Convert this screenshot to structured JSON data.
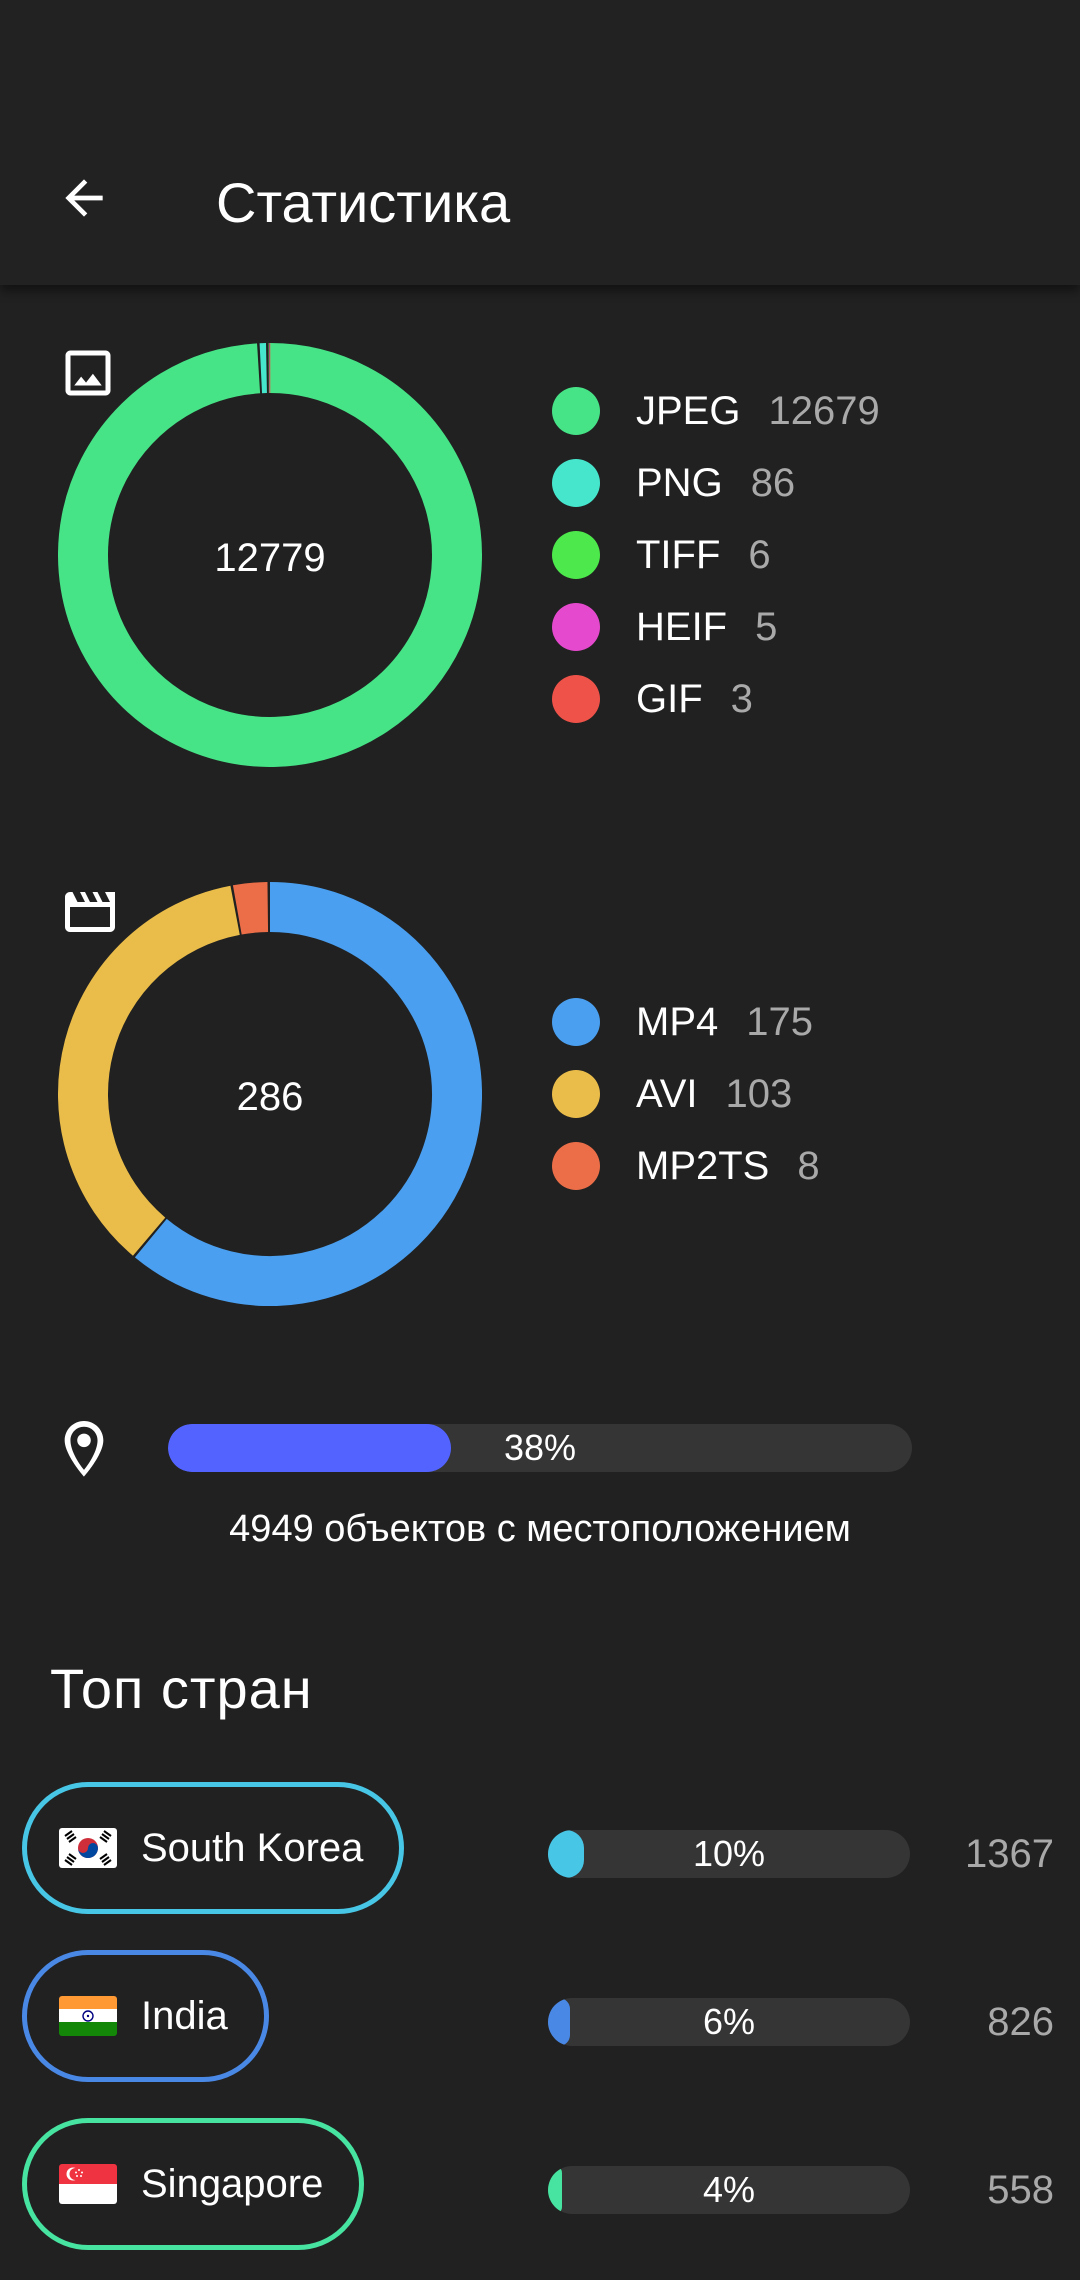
{
  "header": {
    "title": "Статистика",
    "back_icon": "arrow-back-icon"
  },
  "images": {
    "icon": "image-icon",
    "total": "12779",
    "legend": [
      {
        "label": "JPEG",
        "count": "12679",
        "value": 12679,
        "color": "#47e387"
      },
      {
        "label": "PNG",
        "count": "86",
        "value": 86,
        "color": "#46e6cd"
      },
      {
        "label": "TIFF",
        "count": "6",
        "value": 6,
        "color": "#4de84b"
      },
      {
        "label": "HEIF",
        "count": "5",
        "value": 5,
        "color": "#e549cd"
      },
      {
        "label": "GIF",
        "count": "3",
        "value": 3,
        "color": "#ee5249"
      }
    ]
  },
  "videos": {
    "icon": "movie-clapper-icon",
    "total": "286",
    "legend": [
      {
        "label": "MP4",
        "count": "175",
        "value": 175,
        "color": "#4a9ff0"
      },
      {
        "label": "AVI",
        "count": "103",
        "value": 103,
        "color": "#eabd4a"
      },
      {
        "label": "MP2TS",
        "count": "8",
        "value": 8,
        "color": "#eb6e48"
      }
    ]
  },
  "location": {
    "icon": "location-pin-icon",
    "percent_label": "38%",
    "fraction": 0.38,
    "bar_color": "#5363ff",
    "caption": "4949 объектов с местоположением"
  },
  "countries": {
    "title": "Топ стран",
    "items": [
      {
        "name": "South Korea",
        "flag": "south-korea-flag-icon",
        "percent_label": "10%",
        "fraction": 0.1,
        "count": "1367",
        "color": "#47c6e6"
      },
      {
        "name": "India",
        "flag": "india-flag-icon",
        "percent_label": "6%",
        "fraction": 0.06,
        "count": "826",
        "color": "#4a88e6"
      },
      {
        "name": "Singapore",
        "flag": "singapore-flag-icon",
        "percent_label": "4%",
        "fraction": 0.04,
        "count": "558",
        "color": "#47e3a0"
      }
    ]
  }
}
